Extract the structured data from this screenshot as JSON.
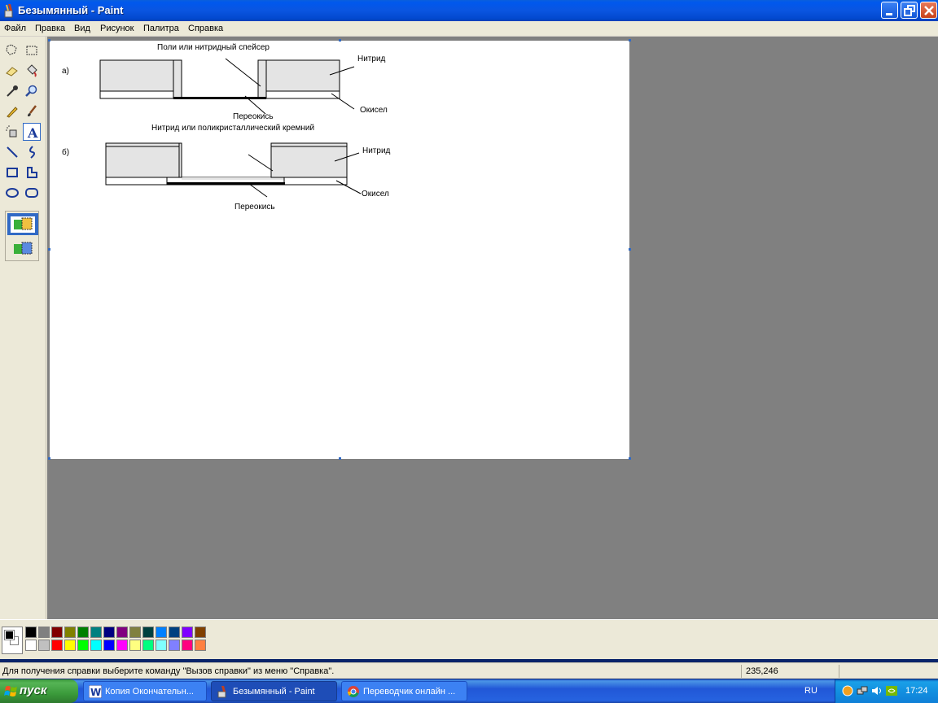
{
  "window": {
    "title": "Безымянный - Paint"
  },
  "menu": [
    "Файл",
    "Правка",
    "Вид",
    "Рисунок",
    "Палитра",
    "Справка"
  ],
  "drawing": {
    "label_a": "а)",
    "label_b": "б)",
    "spacer_label": "Поли или нитридный спейсер",
    "nitride_a": "Нитрид",
    "oxide_a": "Окисел",
    "peroxide_a": "Переокись",
    "nitride_poly_label": "Нитрид или поликристаллический кремний",
    "nitride_b": "Нитрид",
    "oxide_b": "Окисел",
    "peroxide_b": "Переокись"
  },
  "palette": {
    "foreground": "#000000",
    "background": "#ffffff",
    "row1": [
      "#000000",
      "#808080",
      "#800000",
      "#808000",
      "#008000",
      "#008080",
      "#000080",
      "#800080",
      "#808040",
      "#004040",
      "#0080ff",
      "#004080",
      "#8000ff",
      "#804000"
    ],
    "row2": [
      "#ffffff",
      "#c0c0c0",
      "#ff0000",
      "#ffff00",
      "#00ff00",
      "#00ffff",
      "#0000ff",
      "#ff00ff",
      "#ffff80",
      "#00ff80",
      "#80ffff",
      "#8080ff",
      "#ff0080",
      "#ff8040"
    ]
  },
  "status": {
    "help_text": "Для получения справки выберите команду \"Вызов справки\" из меню \"Справка\".",
    "coords": "235,246"
  },
  "taskbar": {
    "start_label": "пуск",
    "tasks": [
      {
        "label": "Копия Окончательн..."
      },
      {
        "label": "Безымянный - Paint"
      },
      {
        "label": "Переводчик онлайн ..."
      }
    ],
    "language": "RU",
    "clock": "17:24"
  }
}
